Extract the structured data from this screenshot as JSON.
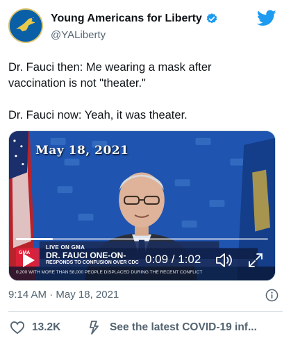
{
  "account": {
    "display_name": "Young Americans for Liberty",
    "handle": "@YALiberty",
    "verified": true
  },
  "tweet": {
    "line1": "Dr. Fauci then: Me wearing a mask after",
    "line2": "vaccination is not \"theater.\"",
    "line3": "Dr. Fauci now: Yeah, it was theater."
  },
  "video": {
    "date_overlay": "May 18, 2021",
    "time_display": "0:09 / 1:02",
    "progress_fraction": 0.145,
    "chyron": {
      "live": "LIVE ON GMA",
      "gma": "GMA",
      "title": "DR. FAUCI ONE-ON-",
      "subtitle": "RESPONDS TO CONFUSION OVER CDC",
      "ticker": "0,200 WITH MORE THAN 58,000 PEOPLE DISPLACED DURING THE RECENT CONFLICT"
    }
  },
  "meta": {
    "timestamp": "9:14 AM · May 18, 2021"
  },
  "actions": {
    "like_count": "13.2K",
    "covid_link": "See the latest COVID-19 inf..."
  },
  "colors": {
    "brand_blue": "#1d9bf0",
    "muted_text": "#536471",
    "heart_icon": "#536471",
    "video_bg": "#1d4fa8"
  },
  "icons": {
    "verified": "verified-badge-icon",
    "bird": "twitter-bird-icon",
    "play": "play-icon",
    "volume": "volume-icon",
    "fullscreen": "fullscreen-icon",
    "info": "info-icon",
    "heart": "heart-icon",
    "covid": "covid-info-icon"
  }
}
